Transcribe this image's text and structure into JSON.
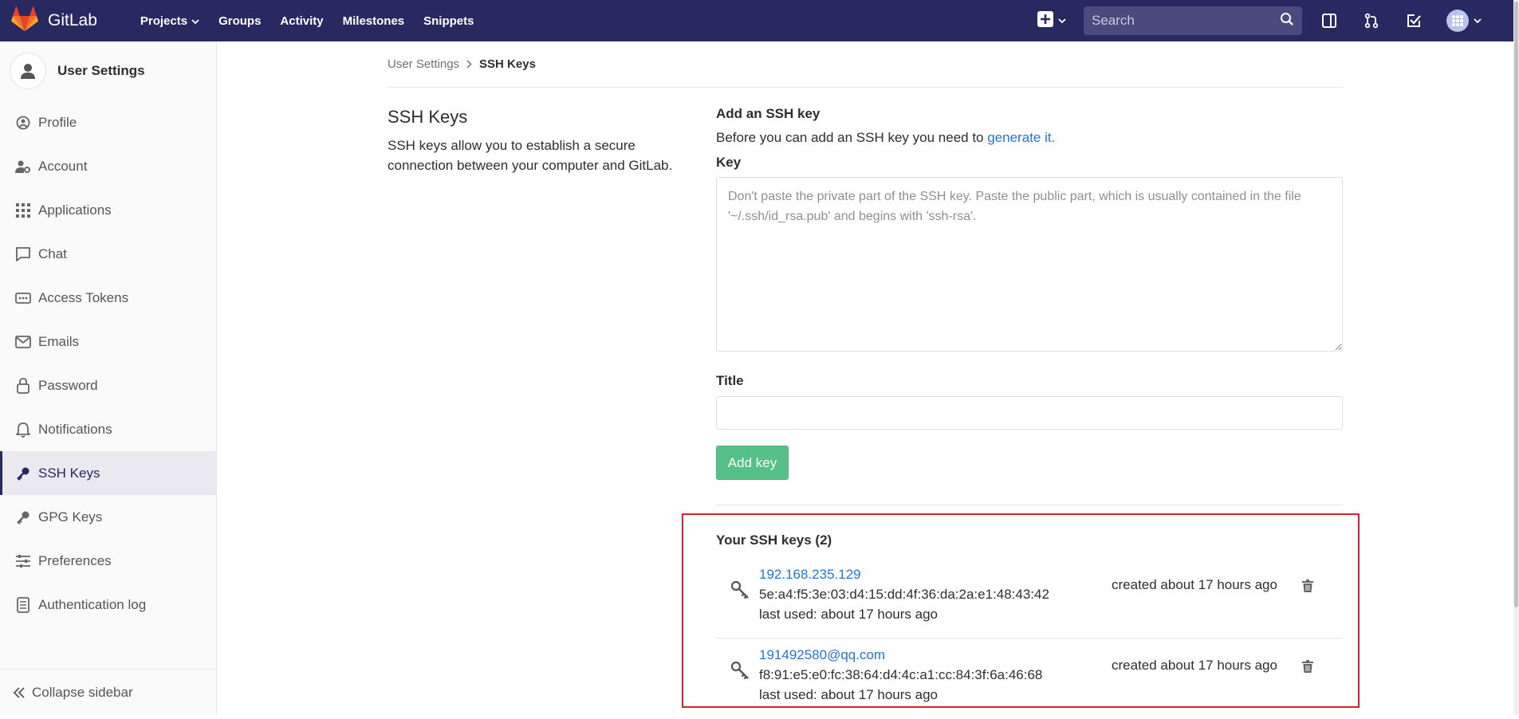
{
  "navbar": {
    "brand": "GitLab",
    "links": [
      "Projects",
      "Groups",
      "Activity",
      "Milestones",
      "Snippets"
    ],
    "search_placeholder": "Search",
    "brand_color": "#292961"
  },
  "sidebar": {
    "title": "User Settings",
    "items": [
      {
        "label": "Profile",
        "icon": "profile-icon"
      },
      {
        "label": "Account",
        "icon": "account-icon"
      },
      {
        "label": "Applications",
        "icon": "applications-icon"
      },
      {
        "label": "Chat",
        "icon": "chat-icon"
      },
      {
        "label": "Access Tokens",
        "icon": "token-icon"
      },
      {
        "label": "Emails",
        "icon": "mail-icon"
      },
      {
        "label": "Password",
        "icon": "lock-icon"
      },
      {
        "label": "Notifications",
        "icon": "bell-icon"
      },
      {
        "label": "SSH Keys",
        "icon": "key-icon",
        "active": true
      },
      {
        "label": "GPG Keys",
        "icon": "key-icon"
      },
      {
        "label": "Preferences",
        "icon": "sliders-icon"
      },
      {
        "label": "Authentication log",
        "icon": "log-icon"
      }
    ],
    "collapse_label": "Collapse sidebar"
  },
  "breadcrumb": {
    "parent": "User Settings",
    "current": "SSH Keys"
  },
  "intro": {
    "title": "SSH Keys",
    "description": "SSH keys allow you to establish a secure connection between your computer and GitLab."
  },
  "form": {
    "title": "Add an SSH key",
    "help_prefix": "Before you can add an SSH key you need to ",
    "help_link": "generate it.",
    "key_label": "Key",
    "key_placeholder": "Don't paste the private part of the SSH key. Paste the public part, which is usually contained in the file '~/.ssh/id_rsa.pub' and begins with 'ssh-rsa'.",
    "title_label": "Title",
    "title_value": "",
    "submit_label": "Add key",
    "submit_color": "#57c08a"
  },
  "keys": {
    "heading": "Your SSH keys (2)",
    "items": [
      {
        "name": "192.168.235.129",
        "fingerprint": "5e:a4:f5:3e:03:d4:15:dd:4f:36:da:2a:e1:48:43:42",
        "last_used": "last used: about 17 hours ago",
        "created": "created about 17 hours ago"
      },
      {
        "name": "191492580@qq.com",
        "fingerprint": "f8:91:e5:e0:fc:38:64:d4:4c:a1:cc:84:3f:6a:46:68",
        "last_used": "last used: about 17 hours ago",
        "created": "created about 17 hours ago"
      }
    ],
    "highlight_color": "#e0202a"
  }
}
